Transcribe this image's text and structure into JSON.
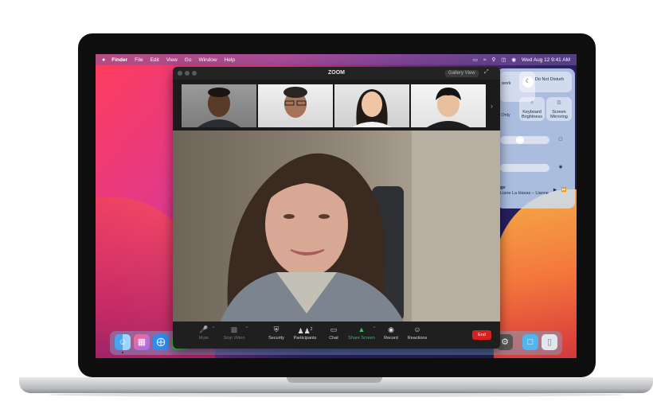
{
  "menubar": {
    "apple": "",
    "items": [
      "Finder",
      "File",
      "Edit",
      "View",
      "Go",
      "Window",
      "Help"
    ],
    "datetime": "Wed Aug 12  9:41 AM"
  },
  "zoom": {
    "title": "ZOOM",
    "gallery_view": "Gallery View",
    "controls": {
      "mute": "Mute",
      "stop_video": "Stop Video",
      "security": "Security",
      "participants": "Participants",
      "participants_count": "2",
      "chat": "Chat",
      "share_screen": "Share Screen",
      "record": "Record",
      "reactions": "Reactions",
      "end": "End"
    }
  },
  "control_center": {
    "dnd": "Do Not Disturb",
    "keyboard_brightness": "Keyboard Brightness",
    "screen_mirroring": "Screen Mirroring",
    "network_partial": "work",
    "only_partial": "Only",
    "music_title_partial": "ge",
    "music_artist_partial": "Liane La Havas – Lianne La H…"
  },
  "colors": {
    "zoom_green": "#32c45f",
    "end_red": "#d8201e",
    "zoom_dark": "#1b1b1c"
  }
}
